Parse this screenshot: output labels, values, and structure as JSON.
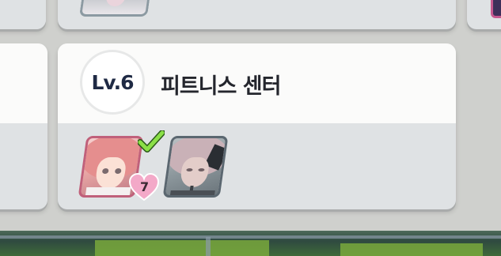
{
  "building_card": {
    "level_label": "Lv.6",
    "title": "피트니스 센터",
    "characters": [
      {
        "name": "character-portrait-1",
        "state": "assigned",
        "affection": "7",
        "checked": true
      },
      {
        "name": "character-portrait-2",
        "state": "unassigned"
      }
    ]
  },
  "colors": {
    "level_text": "#1f2a44",
    "title_text": "#24262d",
    "heart_badge": "#f3a9c8",
    "check": "#7fd13b"
  },
  "icons": [
    "check-icon",
    "heart-icon"
  ]
}
